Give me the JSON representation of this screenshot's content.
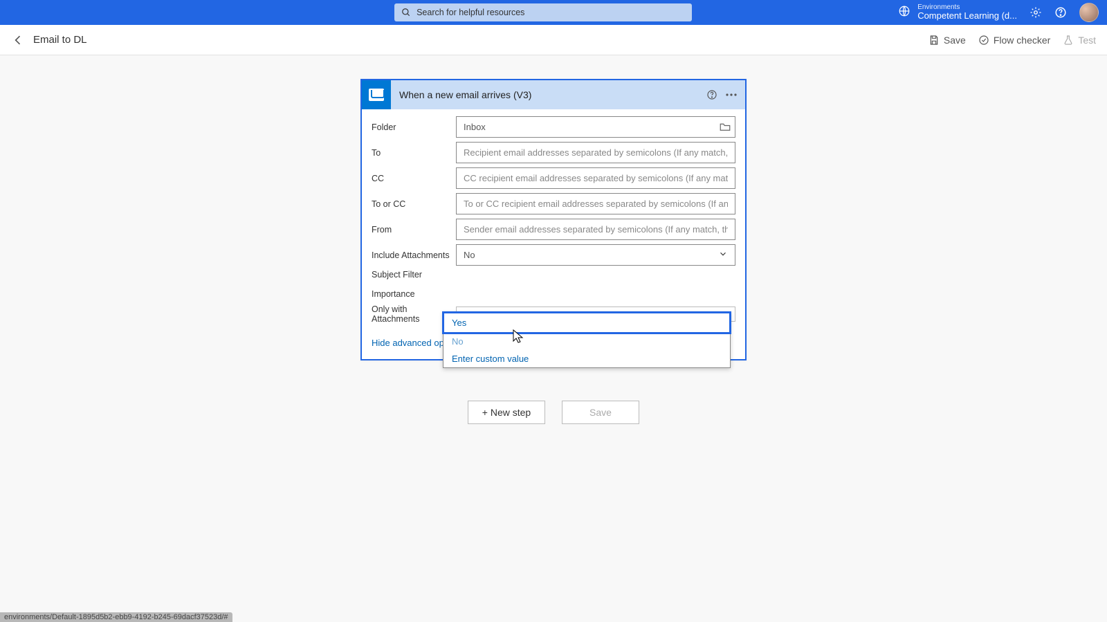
{
  "topbar": {
    "search_placeholder": "Search for helpful resources",
    "env_label": "Environments",
    "env_value": "Competent Learning (d..."
  },
  "subbar": {
    "title": "Email to DL",
    "save": "Save",
    "flow_checker": "Flow checker",
    "test": "Test"
  },
  "trigger": {
    "title": "When a new email arrives (V3)",
    "fields": {
      "folder": {
        "label": "Folder",
        "value": "Inbox"
      },
      "to": {
        "label": "To",
        "placeholder": "Recipient email addresses separated by semicolons (If any match, the"
      },
      "cc": {
        "label": "CC",
        "placeholder": "CC recipient email addresses separated by semicolons (If any match,"
      },
      "to_or_cc": {
        "label": "To or CC",
        "placeholder": "To or CC recipient email addresses separated by semicolons (If any m"
      },
      "from": {
        "label": "From",
        "placeholder": "Sender email addresses separated by semicolons (If any match, the t"
      },
      "include_att": {
        "label": "Include Attachments",
        "value": "No"
      },
      "subject_filter": {
        "label": "Subject Filter"
      },
      "importance": {
        "label": "Importance"
      },
      "only_att": {
        "label": "Only with Attachments"
      }
    },
    "dropdown": {
      "yes": "Yes",
      "no": "No",
      "custom": "Enter custom value"
    },
    "adv_link": "Hide advanced options"
  },
  "bottom": {
    "new_step": "+ New step",
    "save": "Save"
  },
  "status": "environments/Default-1895d5b2-ebb9-4192-b245-69dacf37523d/#"
}
